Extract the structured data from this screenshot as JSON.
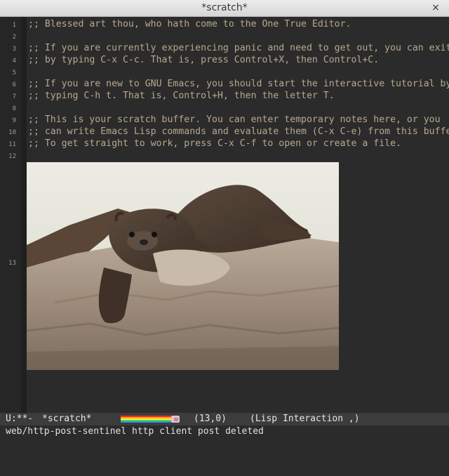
{
  "window": {
    "title": "*scratch*",
    "close_glyph": "×"
  },
  "buffer": {
    "line_numbers": [
      "1",
      "2",
      "3",
      "4",
      "5",
      "6",
      "7",
      "8",
      "9",
      "10",
      "11",
      "12",
      "13"
    ],
    "lines": [
      ";; Blessed art thou, who hath come to the One True Editor.",
      "",
      ";; If you are currently experiencing panic and need to get out, you can exit",
      ";; by typing C-x C-c. That is, press Control+X, then Control+C.",
      "",
      ";; If you are new to GNU Emacs, you should start the interactive tutorial by",
      ";; typing C-h t. That is, Control+H, then the letter T.",
      "",
      ";; This is your scratch buffer. You can enter temporary notes here, or you",
      ";; can write Emacs Lisp commands and evaluate them (C-x C-e) from this buffer.",
      ";; To get straight to work, press C-x C-f to open or create a file.",
      ""
    ],
    "image_icon": "otter-photo"
  },
  "modeline": {
    "state": "U:**-",
    "buffer_name": "*scratch*",
    "position": "(13,0)",
    "mode": "(Lisp Interaction ,)",
    "nyan_icon": "nyan-cat-progress"
  },
  "echo_area": {
    "message": "web/http-post-sentinel http client post deleted"
  },
  "colors": {
    "comment": "#b8a88f",
    "background": "#2b2b2b",
    "modeline": "#3c3c3c"
  }
}
